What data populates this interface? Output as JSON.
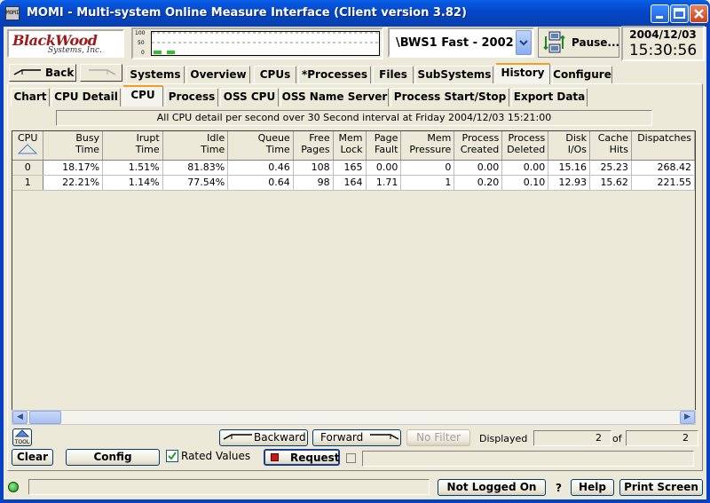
{
  "window": {
    "title": "MOMI - Multi-system Online Measure Interface (Client version 3.82)",
    "icon_label": "MOMI",
    "controls": [
      "minimize-icon",
      "maximize-icon",
      "close-icon"
    ]
  },
  "logo": {
    "main": "BlackWood",
    "sub": "Systems, Inc."
  },
  "mini_chart": {
    "axis_labels": [
      "100",
      "50",
      "0"
    ],
    "bars": [
      0.15,
      0.15
    ]
  },
  "system": {
    "selected": "\\BWS1 Fast - 2002"
  },
  "pause": {
    "label": "Pause..."
  },
  "datetime": {
    "date": "2004/12/03",
    "time": "15:30:56"
  },
  "nav": {
    "back_label": "Back"
  },
  "main_tabs": [
    {
      "label": "Systems"
    },
    {
      "label": "Overview"
    },
    {
      "label": "CPUs"
    },
    {
      "label": "*Processes"
    },
    {
      "label": "Files"
    },
    {
      "label": "SubSystems"
    },
    {
      "label": "History"
    },
    {
      "label": "Configure"
    }
  ],
  "main_tab_active": "History",
  "sub_tabs": [
    {
      "label": "Chart"
    },
    {
      "label": "CPU Detail"
    },
    {
      "label": "CPU"
    },
    {
      "label": "Process"
    },
    {
      "label": "OSS CPU"
    },
    {
      "label": "OSS Name Server"
    },
    {
      "label": "Process Start/Stop"
    },
    {
      "label": "Export Data"
    }
  ],
  "sub_tab_active": "CPU",
  "caption": "All CPU detail per second over 30 Second interval at Friday 2004/12/03 15:21:00",
  "table": {
    "columns": [
      [
        "CPU",
        ""
      ],
      [
        "Busy",
        "Time"
      ],
      [
        "Irupt",
        "Time"
      ],
      [
        "Idle",
        "Time"
      ],
      [
        "Queue",
        "Time"
      ],
      [
        "Free",
        "Pages"
      ],
      [
        "Mem",
        "Lock"
      ],
      [
        "Page",
        "Fault"
      ],
      [
        "Mem",
        "Pressure"
      ],
      [
        "Process",
        "Created"
      ],
      [
        "Process",
        "Deleted"
      ],
      [
        "Disk",
        "I/Os"
      ],
      [
        "Cache",
        "Hits"
      ],
      [
        "Dispatches",
        ""
      ]
    ],
    "rows": [
      [
        "0",
        "18.17%",
        "1.51%",
        "81.83%",
        "0.46",
        "108",
        "165",
        "0.00",
        "0",
        "0.00",
        "0.00",
        "15.16",
        "25.23",
        "268.42"
      ],
      [
        "1",
        "22.21%",
        "1.14%",
        "77.54%",
        "0.64",
        "98",
        "164",
        "1.71",
        "1",
        "0.20",
        "0.10",
        "12.93",
        "15.62",
        "221.55"
      ]
    ]
  },
  "toolbar": {
    "tool_label": "TOOL",
    "backward_label": "Backward",
    "forward_label": "Forward",
    "nofilter_label": "No Filter",
    "displayed_label": "Displayed",
    "displayed_value": "2",
    "of_label": "of",
    "total_value": "2",
    "clear_label": "Clear",
    "config_label": "Config",
    "rated_label": "Rated Values",
    "rated_checked": true,
    "request_label": "Request"
  },
  "status": {
    "login_label": "Not Logged On",
    "question": "?",
    "help_label": "Help",
    "print_label": "Print Screen"
  }
}
